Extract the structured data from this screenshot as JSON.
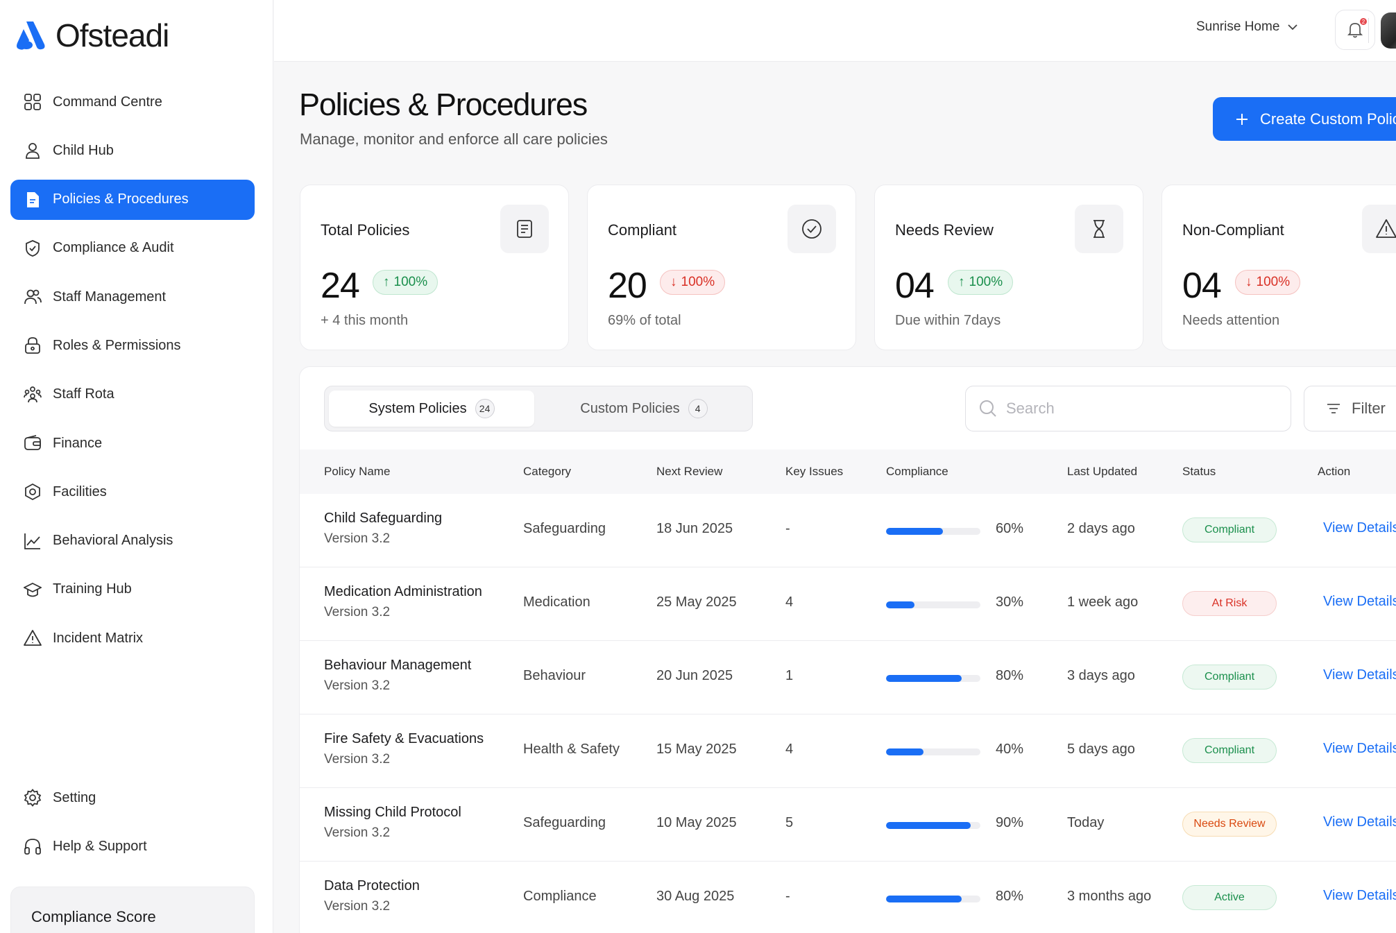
{
  "app": {
    "name": "Ofsteadi"
  },
  "sidebar": {
    "items": [
      {
        "label": "Command Centre",
        "icon": "grid-icon"
      },
      {
        "label": "Child Hub",
        "icon": "user-icon"
      },
      {
        "label": "Policies & Procedures",
        "icon": "document-icon",
        "active": true
      },
      {
        "label": "Compliance & Audit",
        "icon": "shield-check-icon"
      },
      {
        "label": "Staff Management",
        "icon": "users-icon"
      },
      {
        "label": "Roles & Permissions",
        "icon": "lock-icon"
      },
      {
        "label": "Staff Rota",
        "icon": "team-icon"
      },
      {
        "label": "Finance",
        "icon": "wallet-icon"
      },
      {
        "label": "Facilities",
        "icon": "hexagon-icon"
      },
      {
        "label": "Behavioral Analysis",
        "icon": "chart-line-icon"
      },
      {
        "label": "Training Hub",
        "icon": "graduation-cap-icon"
      },
      {
        "label": "Incident Matrix",
        "icon": "warning-icon"
      }
    ],
    "bottom": [
      {
        "label": "Setting",
        "icon": "gear-icon"
      },
      {
        "label": "Help & Support",
        "icon": "headphones-icon"
      }
    ],
    "score_title": "Compliance Score"
  },
  "topbar": {
    "home": "Sunrise Home",
    "notification_count": "2"
  },
  "header": {
    "title": "Policies & Procedures",
    "subtitle": "Manage, monitor and enforce all care policies",
    "create_label": "Create Custom Policy"
  },
  "stats": [
    {
      "label": "Total Policies",
      "value": "24",
      "change": "100%",
      "direction": "up",
      "note": "+ 4 this month",
      "icon": "document-icon"
    },
    {
      "label": "Compliant",
      "value": "20",
      "change": "100%",
      "direction": "down",
      "note": "69% of total",
      "icon": "check-circle-icon"
    },
    {
      "label": "Needs Review",
      "value": "04",
      "change": "100%",
      "direction": "up",
      "note": "Due within 7days",
      "icon": "hourglass-icon"
    },
    {
      "label": "Non-Compliant",
      "value": "04",
      "change": "100%",
      "direction": "down",
      "note": "Needs attention",
      "icon": "warning-icon"
    }
  ],
  "tabs": [
    {
      "label": "System Policies",
      "count": "24"
    },
    {
      "label": "Custom Policies",
      "count": "4"
    }
  ],
  "search": {
    "placeholder": "Search"
  },
  "filter_label": "Filter",
  "table": {
    "columns": [
      "Policy Name",
      "Category",
      "Next Review",
      "Key Issues",
      "Compliance",
      "Last Updated",
      "Status",
      "Action"
    ],
    "rows": [
      {
        "name": "Child Safeguarding",
        "version": "Version 3.2",
        "category": "Safeguarding",
        "next_review": "18 Jun 2025",
        "issues": "-",
        "compliance": 60,
        "compliance_label": "60%",
        "updated": "2 days ago",
        "status": "Compliant",
        "status_type": "compliant",
        "action": "View Details"
      },
      {
        "name": "Medication Administration",
        "version": "Version 3.2",
        "category": "Medication",
        "next_review": "25 May 2025",
        "issues": "4",
        "compliance": 30,
        "compliance_label": "30%",
        "updated": "1 week ago",
        "status": "At Risk",
        "status_type": "risk",
        "action": "View Details"
      },
      {
        "name": "Behaviour Management",
        "version": "Version 3.2",
        "category": "Behaviour",
        "next_review": "20 Jun 2025",
        "issues": "1",
        "compliance": 80,
        "compliance_label": "80%",
        "updated": "3 days ago",
        "status": "Compliant",
        "status_type": "compliant",
        "action": "View Details"
      },
      {
        "name": "Fire Safety & Evacuations",
        "version": "Version 3.2",
        "category": "Health & Safety",
        "next_review": "15 May 2025",
        "issues": "4",
        "compliance": 40,
        "compliance_label": "40%",
        "updated": "5 days ago",
        "status": "Compliant",
        "status_type": "compliant",
        "action": "View Details"
      },
      {
        "name": "Missing Child Protocol",
        "version": "Version 3.2",
        "category": "Safeguarding",
        "next_review": "10 May 2025",
        "issues": "5",
        "compliance": 90,
        "compliance_label": "90%",
        "updated": "Today",
        "status": "Needs Review",
        "status_type": "review",
        "action": "View Details"
      },
      {
        "name": "Data Protection",
        "version": "Version 3.2",
        "category": "Compliance",
        "next_review": "30 Aug 2025",
        "issues": "-",
        "compliance": 80,
        "compliance_label": "80%",
        "updated": "3 months ago",
        "status": "Active",
        "status_type": "active",
        "action": "View Details"
      }
    ]
  },
  "colors": {
    "accent": "#1a6ef5",
    "success": "#1a8f4c",
    "danger": "#d93025",
    "warning": "#d9480f"
  }
}
